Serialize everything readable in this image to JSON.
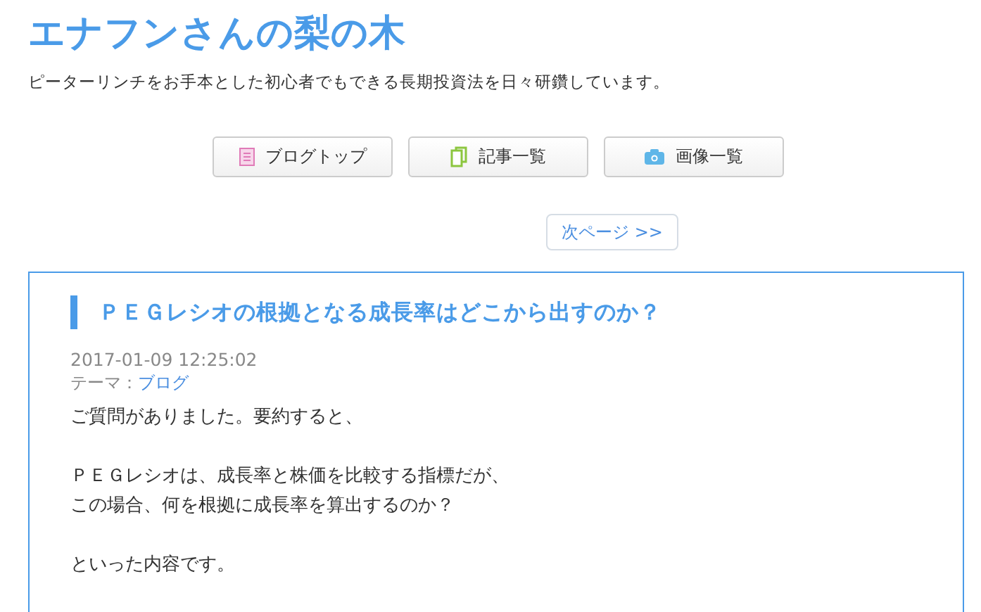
{
  "header": {
    "title": "エナフンさんの梨の木",
    "subtitle": "ピーターリンチをお手本とした初心者でもできる長期投資法を日々研鑽しています。"
  },
  "nav_buttons": [
    {
      "label": "ブログトップ",
      "kind": "list"
    },
    {
      "label": "記事一覧",
      "kind": "document"
    },
    {
      "label": "画像一覧",
      "kind": "camera"
    }
  ],
  "next_page": "次ページ >>",
  "article": {
    "title": "ＰＥＧレシオの根拠となる成長率はどこから出すのか？",
    "date": "2017-01-09 12:25:02",
    "theme_label": "テーマ：",
    "theme": "ブログ",
    "paragraphs": [
      [
        "ご質問がありました。要約すると、"
      ],
      [
        "ＰＥＧレシオは、成長率と株価を比較する指標だが、",
        "この場合、何を根拠に成長率を算出するのか？"
      ],
      [
        "といった内容です。"
      ]
    ]
  }
}
